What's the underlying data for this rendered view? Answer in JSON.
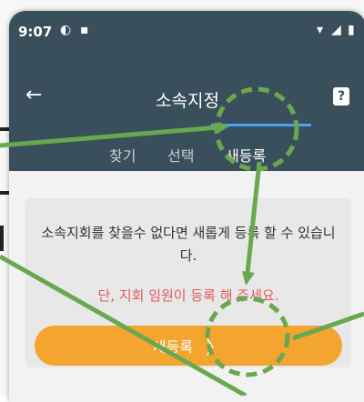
{
  "status": {
    "time": "9:07"
  },
  "header": {
    "title": "소속지정"
  },
  "tabs": [
    {
      "label": "찾기"
    },
    {
      "label": "선택"
    },
    {
      "label": "새등록"
    }
  ],
  "content": {
    "message": "소속지회를 찾을수 없다면 새롭게 등록 할 수 있습니다.",
    "warning": "단, 지회 임원이 등록 해 주세요.",
    "button_label": "새등록"
  },
  "colors": {
    "header_bg": "#3a4f5c",
    "accent": "#f4a530",
    "warning": "#e25a5a",
    "annotation": "#6aa84f"
  },
  "icons": [
    "back-arrow-icon",
    "help-icon",
    "chevron-right-icon",
    "wifi-icon",
    "signal-icon",
    "battery-icon"
  ]
}
